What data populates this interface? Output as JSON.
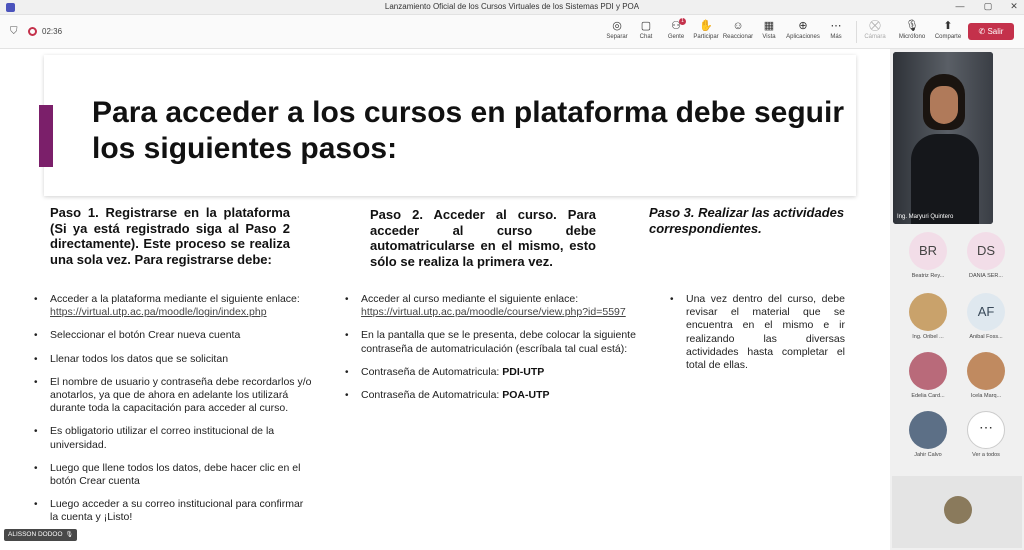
{
  "window": {
    "title": "Lanzamiento Oficial de los Cursos Virtuales de los Sistemas PDI y POA",
    "controls": [
      "—",
      "▢",
      "✕"
    ]
  },
  "meeting": {
    "timer": "02:36",
    "toolbar": [
      {
        "icon": "share-tray-icon",
        "glyph": "◎",
        "label": "Separar"
      },
      {
        "icon": "chat-icon",
        "glyph": "💬",
        "label": "Chat"
      },
      {
        "icon": "people-icon",
        "glyph": "👥",
        "label": "Gente",
        "badge": "1"
      },
      {
        "icon": "raise-hand-icon",
        "glyph": "✋",
        "label": "Participar"
      },
      {
        "icon": "react-icon",
        "glyph": "☺",
        "label": "Reaccionar"
      },
      {
        "icon": "view-icon",
        "glyph": "▦",
        "label": "Vista"
      },
      {
        "icon": "apps-icon",
        "glyph": "⊕",
        "label": "Aplicaciones"
      },
      {
        "icon": "more-icon",
        "glyph": "⋯",
        "label": "Más"
      }
    ],
    "camera_label": "Cámara",
    "mic_label": "Micrófono",
    "share_label": "Comparte",
    "leave_label": "Salir"
  },
  "slide": {
    "title": "Para acceder a los cursos en plataforma debe seguir los siguientes pasos:",
    "step1": {
      "title": "Paso 1. Registrarse en la plataforma (Si ya está registrado siga al Paso 2 directamente). Este proceso se realiza una sola vez. Para registrarse debe:",
      "bullets": [
        {
          "text": "Acceder a la plataforma mediante el siguiente enlace:",
          "link": "https://virtual.utp.ac.pa/moodle/login/index.php"
        },
        {
          "text": "Seleccionar el botón Crear nueva cuenta"
        },
        {
          "text": "Llenar todos los datos que se solicitan"
        },
        {
          "text": "El nombre de usuario y contraseña debe recordarlos y/o anotarlos, ya que de ahora en adelante los utilizará durante toda la capacitación para acceder al curso."
        },
        {
          "text": "Es obligatorio utilizar el correo institucional de la universidad."
        },
        {
          "text": "Luego que llene todos los datos, debe hacer clic en el botón Crear cuenta"
        },
        {
          "text": "Luego acceder a su correo institucional para confirmar la cuenta y ¡Listo!"
        }
      ]
    },
    "step2": {
      "title": "Paso 2. Acceder al curso. Para acceder al curso debe automatricularse en el mismo, esto sólo se realiza la primera vez.",
      "bullets": [
        {
          "text": "Acceder al curso mediante el siguiente enlace:",
          "link": "https://virtual.utp.ac.pa/moodle/course/view.php?id=5597"
        },
        {
          "text": "En la pantalla que se le presenta, debe colocar la siguiente contraseña de automatriculación (escríbala tal cual está):"
        },
        {
          "text": "Contraseña de Automatricula:",
          "strong": "PDI-UTP"
        },
        {
          "text": "Contraseña de Automatricula:",
          "strong": "POA-UTP"
        }
      ]
    },
    "step3": {
      "title": "Paso 3. Realizar las actividades correspondientes.",
      "bullets": [
        {
          "text": "Una vez dentro del curso, debe revisar el material que se encuentra en el mismo e ir realizando las diversas actividades hasta completar el total de ellas."
        }
      ]
    }
  },
  "presenter_tag": "ALISSON DODOO",
  "sidebar": {
    "main_video_name": "Ing. Maryuri Quintero",
    "participants": [
      {
        "initials": "BR",
        "name": "Beatriz Rey...",
        "bg": "#f2dde8",
        "fg": "#444"
      },
      {
        "initials": "DS",
        "name": "DANIA SER...",
        "bg": "#f2dde8",
        "fg": "#444"
      },
      {
        "initials": "",
        "name": "Ing. Oribel ...",
        "bg": "#c9a26b",
        "fg": "#fff"
      },
      {
        "initials": "AF",
        "name": "Anibal Foss...",
        "bg": "#dfe8ef",
        "fg": "#3a4a5a"
      },
      {
        "initials": "",
        "name": "Edelia Card...",
        "bg": "#b96a7a",
        "fg": "#fff"
      },
      {
        "initials": "",
        "name": "Icela Marq...",
        "bg": "#c08a60",
        "fg": "#fff"
      },
      {
        "initials": "",
        "name": "Jahir Calvo",
        "bg": "#5c6f86",
        "fg": "#fff"
      }
    ],
    "more_label": "Ver a todos"
  }
}
